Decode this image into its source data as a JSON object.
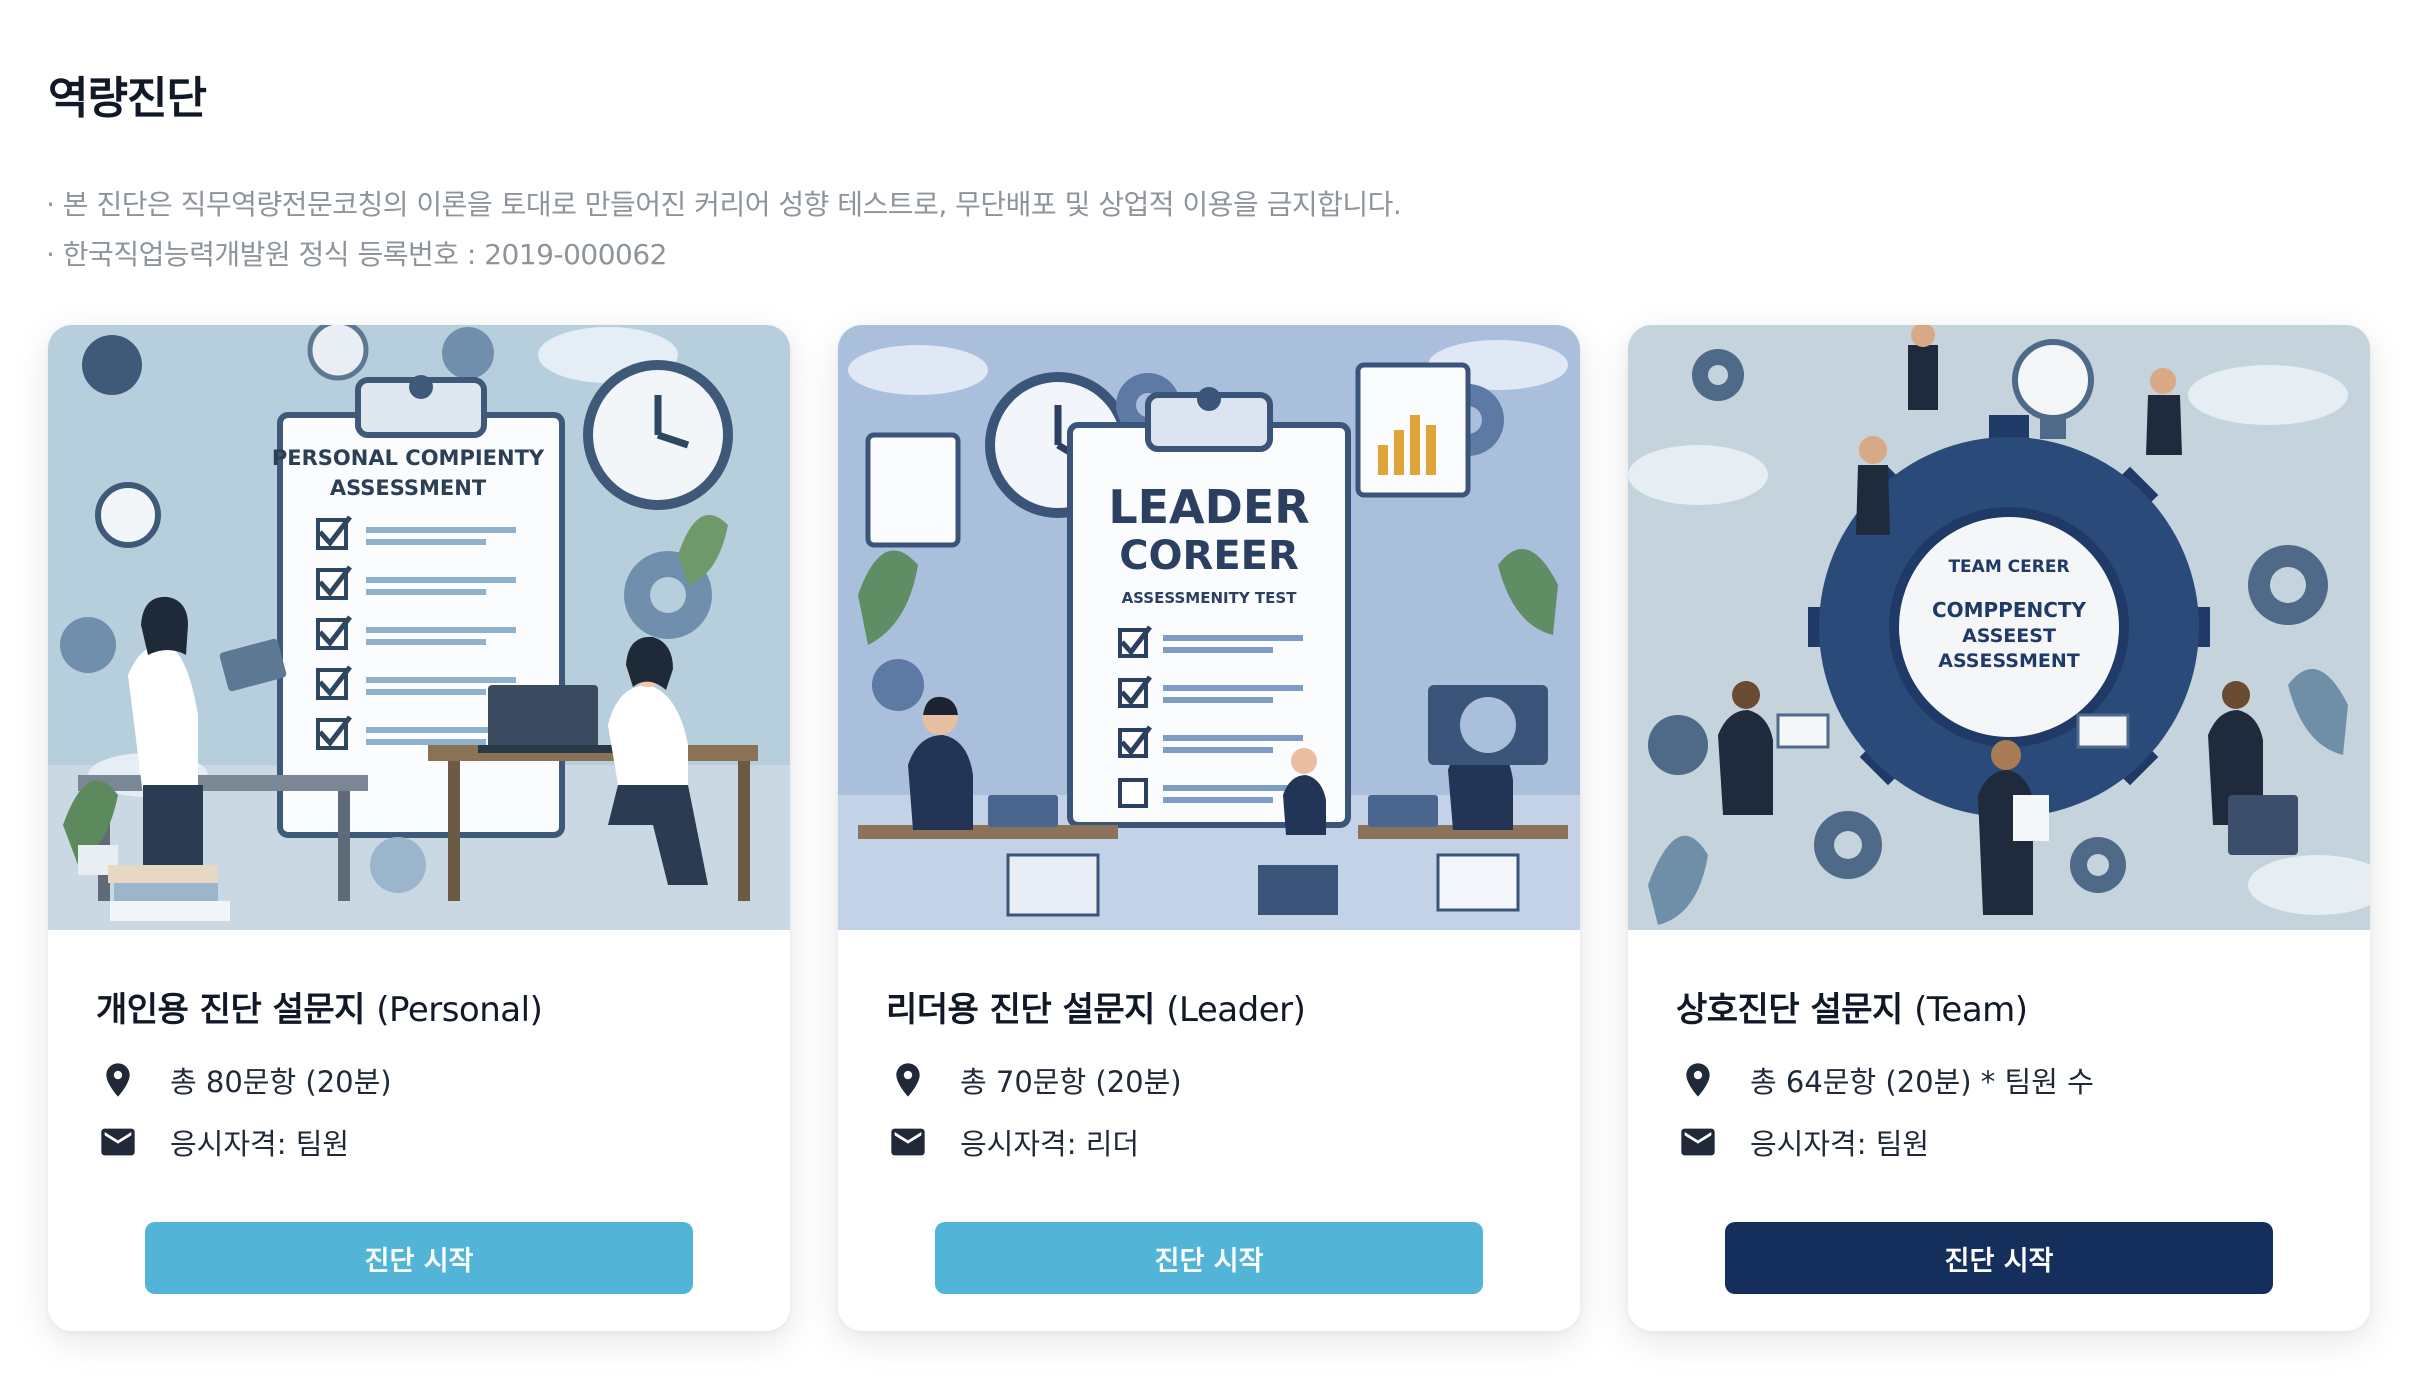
{
  "page": {
    "title": "역량진단",
    "notices": [
      "· 본 진단은 직무역량전문코칭의 이론을 토대로 만들어진 커리어 성향 테스트로, 무단배포 및 상업적 이용을 금지합니다.",
      "· 한국직업능력개발원 정식 등록번호 : 2019-000062"
    ]
  },
  "cards": [
    {
      "title": "개인용 진단 설문지",
      "title_en": "(Personal)",
      "image_text": [
        "PERSONAL COMPIENTY",
        "ASSESSMENT"
      ],
      "questions": "총 80문항 (20분)",
      "eligibility": "응시자격: 팀원",
      "button": "진단 시작",
      "button_color": "#52b4d6"
    },
    {
      "title": "리더용 진단 설문지",
      "title_en": "(Leader)",
      "image_text": [
        "LEADER",
        "COREER",
        "ASSESSMENITY TEST"
      ],
      "questions": "총 70문항 (20분)",
      "eligibility": "응시자격: 리더",
      "button": "진단 시작",
      "button_color": "#52b4d6"
    },
    {
      "title": "상호진단 설문지",
      "title_en": "(Team)",
      "image_text": [
        "TEAM CERER",
        "COMPPENCTY",
        "ASSEEST",
        "ASSESSMENT"
      ],
      "questions": "총 64문항 (20분) * 팀원 수",
      "eligibility": "응시자격: 팀원",
      "button": "진단 시작",
      "button_color": "#152f5c"
    }
  ],
  "icons": {
    "questions_icon": "location-pin-icon",
    "eligibility_icon": "mail-icon"
  },
  "colors": {
    "accent_light": "#52b4d6",
    "accent_dark": "#152f5c",
    "notice_text": "#8e949c"
  }
}
